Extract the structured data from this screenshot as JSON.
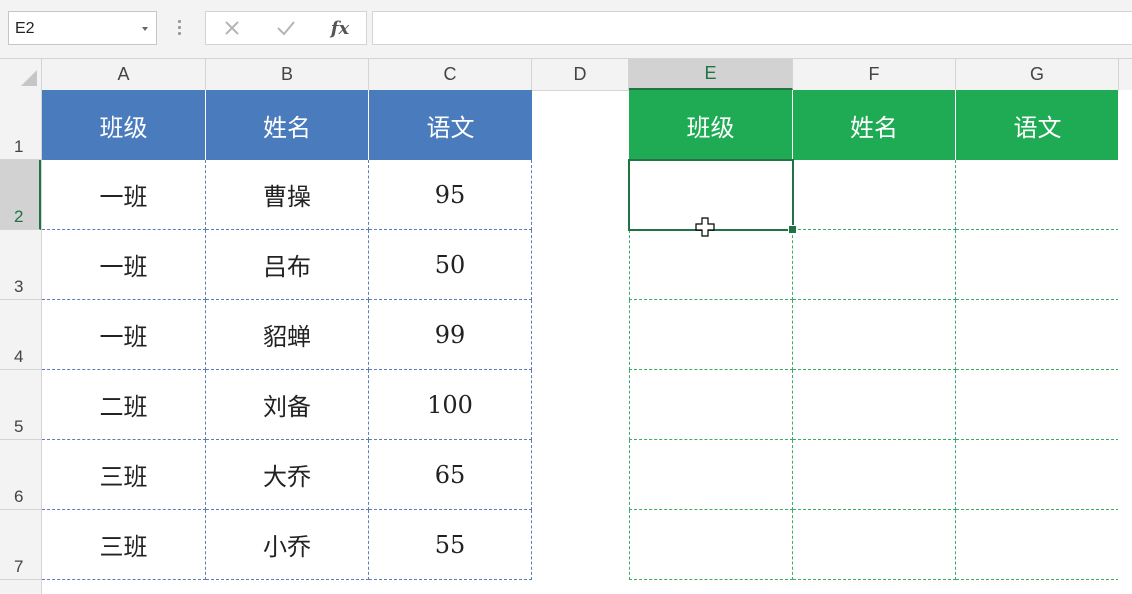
{
  "formula_bar": {
    "name_box": "E2",
    "cancel_icon": "close-icon",
    "enter_icon": "check-icon",
    "fx_label": "fx",
    "formula": ""
  },
  "columns": [
    "A",
    "B",
    "C",
    "D",
    "E",
    "F",
    "G"
  ],
  "active_column": "E",
  "rows": [
    "1",
    "2",
    "3",
    "4",
    "5",
    "6",
    "7"
  ],
  "active_row": "2",
  "source_table": {
    "headers": [
      "班级",
      "姓名",
      "语文"
    ],
    "rows": [
      [
        "一班",
        "曹操",
        "95"
      ],
      [
        "一班",
        "吕布",
        "50"
      ],
      [
        "一班",
        "貂蝉",
        "99"
      ],
      [
        "二班",
        "刘备",
        "100"
      ],
      [
        "三班",
        "大乔",
        "65"
      ],
      [
        "三班",
        "小乔",
        "55"
      ]
    ]
  },
  "target_table": {
    "headers": [
      "班级",
      "姓名",
      "语文"
    ],
    "rows": [
      [
        "",
        "",
        ""
      ],
      [
        "",
        "",
        ""
      ],
      [
        "",
        "",
        ""
      ],
      [
        "",
        "",
        ""
      ],
      [
        "",
        "",
        ""
      ],
      [
        "",
        "",
        ""
      ]
    ]
  },
  "selected_cell": "E2",
  "colors": {
    "source_header": "#4a7bbd",
    "target_header": "#1eab54",
    "selection": "#217346"
  }
}
